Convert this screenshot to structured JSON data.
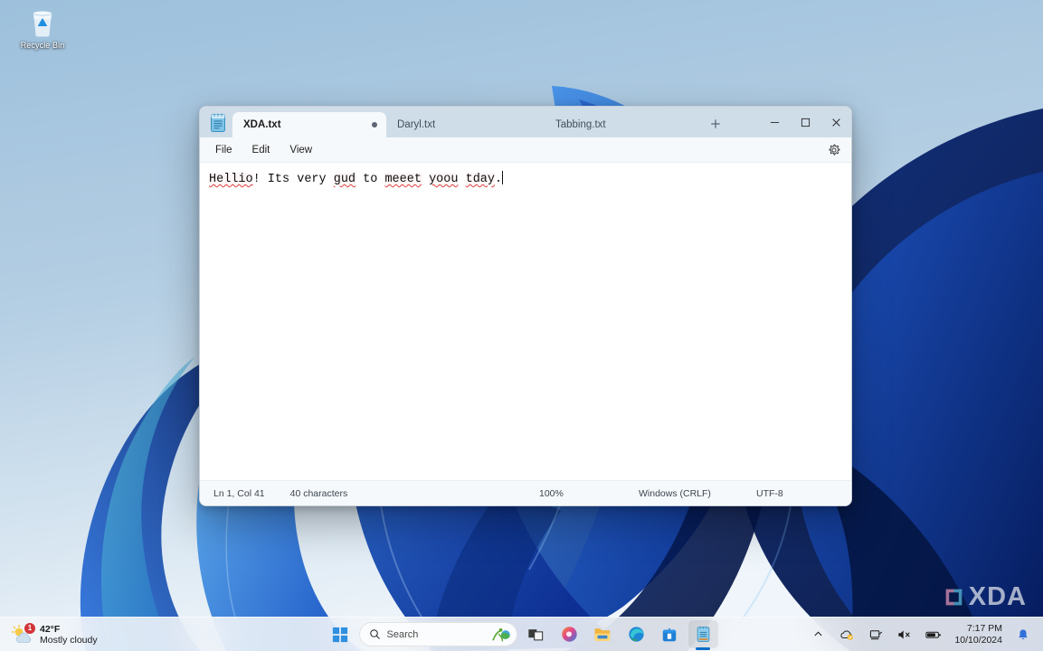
{
  "desktop": {
    "recycle_bin_label": "Recycle Bin",
    "watermark_text": "XDA"
  },
  "notepad": {
    "app_icon_name": "notepad-icon",
    "tabs": [
      {
        "title": "XDA.txt",
        "active": true,
        "modified": true
      },
      {
        "title": "Daryl.txt",
        "active": false,
        "modified": false
      },
      {
        "title": "Tabbing.txt",
        "active": false,
        "modified": false
      }
    ],
    "new_tab_label": "+",
    "caption": {
      "minimize": "─",
      "maximize": "☐",
      "close": "✕"
    },
    "menu": [
      {
        "label": "File"
      },
      {
        "label": "Edit"
      },
      {
        "label": "View"
      }
    ],
    "settings_label": "Settings",
    "document": {
      "segments": [
        {
          "text": "Hellio",
          "misspelled": true
        },
        {
          "text": "! Its very ",
          "misspelled": false
        },
        {
          "text": "gud",
          "misspelled": true
        },
        {
          "text": " to ",
          "misspelled": false
        },
        {
          "text": "meeet",
          "misspelled": true
        },
        {
          "text": " ",
          "misspelled": false
        },
        {
          "text": "yoou",
          "misspelled": true
        },
        {
          "text": " ",
          "misspelled": false
        },
        {
          "text": "tday",
          "misspelled": true
        },
        {
          "text": ".",
          "misspelled": false
        }
      ],
      "plain_text": "Hellio! Its very gud to meeet yoou tday."
    },
    "status": {
      "cursor": "Ln 1, Col 41",
      "char_count": "40 characters",
      "zoom": "100%",
      "line_ending": "Windows (CRLF)",
      "encoding": "UTF-8"
    }
  },
  "taskbar": {
    "weather": {
      "temperature": "42°F",
      "condition": "Mostly cloudy",
      "badge": "1",
      "icon": "partly-cloudy-icon"
    },
    "start_label": "Start",
    "search": {
      "placeholder": "Search",
      "icon": "search-icon"
    },
    "apps": [
      {
        "name": "task-view",
        "label": "Task view",
        "active": false
      },
      {
        "name": "copilot",
        "label": "Copilot",
        "active": false
      },
      {
        "name": "file-explorer",
        "label": "File Explorer",
        "active": false
      },
      {
        "name": "edge",
        "label": "Microsoft Edge",
        "active": false
      },
      {
        "name": "microsoft-store",
        "label": "Microsoft Store",
        "active": false
      },
      {
        "name": "notepad",
        "label": "Notepad",
        "active": true
      }
    ],
    "tray": {
      "overflow_label": "Show hidden icons",
      "onedrive_label": "OneDrive",
      "network_label": "Network",
      "volume_label": "Volume muted",
      "battery_label": "Battery",
      "time": "7:17 PM",
      "date": "10/10/2024",
      "notifications_label": "Notifications"
    }
  },
  "colors": {
    "accent": "#0d6ec9",
    "titlebar": "#cfdde9",
    "surface": "#f6f9fb",
    "spell_error": "#e04343",
    "badge": "#d13438"
  }
}
